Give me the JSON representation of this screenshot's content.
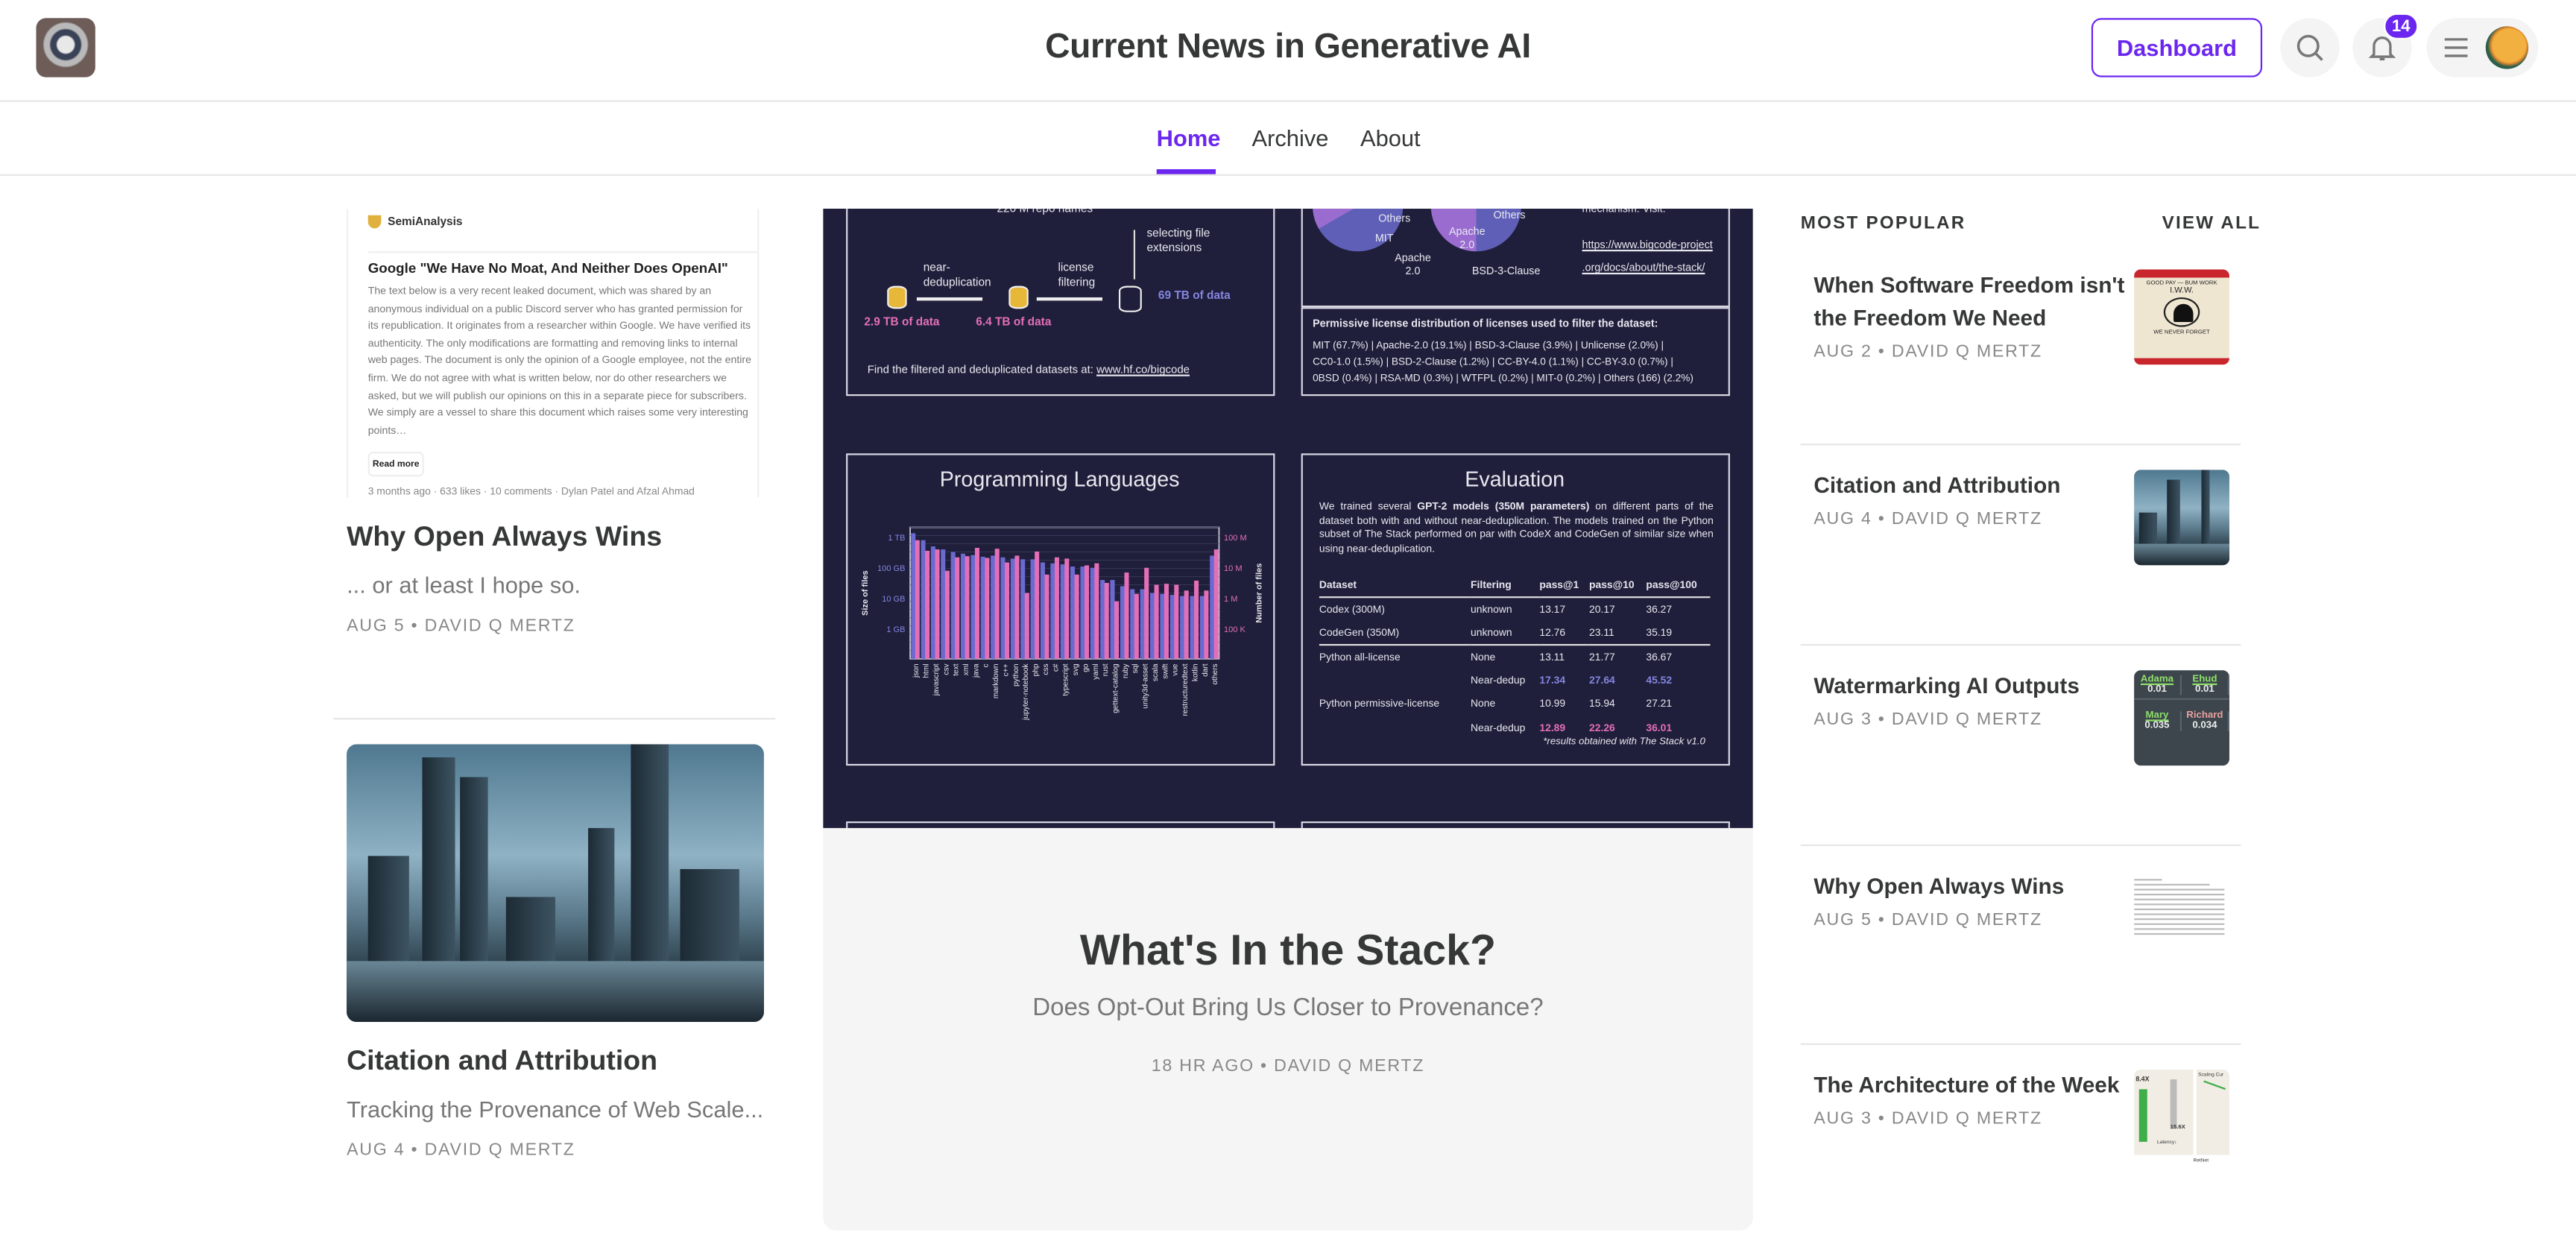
{
  "header": {
    "title": "Current News in Generative AI",
    "dashboard_label": "Dashboard",
    "notification_count": "14",
    "accent_color": "#6b26f0"
  },
  "nav": {
    "tabs": [
      {
        "label": "Home",
        "active": true
      },
      {
        "label": "Archive"
      },
      {
        "label": "About"
      }
    ]
  },
  "left_posts": [
    {
      "title": "Why Open Always Wins",
      "subtitle": "... or at least I hope so.",
      "meta": "AUG 5 • DAVID Q MERTZ",
      "image": {
        "publisher": "SemiAnalysis",
        "heading": "Google \"We Have No Moat, And Neither Does OpenAI\"",
        "body": "The text below is a very recent leaked document, which was shared by an anonymous individual on a public Discord server who has granted permission for its republication. It originates from a researcher within Google. We have verified its authenticity. The only modifications are formatting and removing links to internal web pages. The document is only the opinion of a Google employee, not the entire firm. We do not agree with what is written below, nor do other researchers we asked, but we will publish our opinions on this in a separate piece for subscribers. We simply are a vessel to share this document which raises some very interesting points…",
        "read_more": "Read more",
        "meta": "3 months ago · 633 likes · 10 comments · Dylan Patel and Afzal Ahmad"
      }
    },
    {
      "title": "Citation and Attribution",
      "subtitle": "Tracking the Provenance of Web Scale...",
      "meta": "AUG 4 • DAVID Q MERTZ"
    }
  ],
  "hero": {
    "title": "What's In the Stack?",
    "subtitle": "Does Opt-Out Bring Us Closer to Provenance?",
    "meta": "18 HR AGO • DAVID Q MERTZ",
    "image": {
      "pipeline": {
        "repo_names": "220 M repo names",
        "select_step": "selecting file extensions",
        "license_step": "license filtering",
        "dedup_step": "near-deduplication",
        "size_raw": "69 TB of data",
        "size_license": "6.4 TB of data",
        "size_dedup": "2.9 TB of data",
        "find_text": "Find the filtered and deduplicated datasets at:",
        "find_link": "www.hf.co/bigcode"
      },
      "pies": {
        "labels": [
          "Others",
          "MIT",
          "Apache 2.0",
          "Others",
          "Apache 2.0",
          "BSD-3-Clause"
        ],
        "mechanism": "mechanism. Visit:",
        "link1": "https://www.bigcode-project",
        "link2": ".org/docs/about/the-stack/"
      },
      "license_dist": {
        "title": "Permissive license distribution of licenses used to filter the dataset:",
        "lines": [
          "MIT (67.7%) | Apache-2.0 (19.1%) | BSD-3-Clause (3.9%) | Unlicense (2.0%) |",
          "CC0-1.0 (1.5%) | BSD-2-Clause (1.2%) | CC-BY-4.0 (1.1%) | CC-BY-3.0 (0.7%) |",
          "0BSD (0.4%) | RSA-MD (0.3%) | WTFPL (0.2%) | MIT-0 (0.2%) | Others (166) (2.2%)"
        ]
      },
      "languages_chart": {
        "type": "bar",
        "title": "Programming Languages",
        "ylabel": "Size of files",
        "y2label": "Number of files",
        "yticks": [
          "1 TB",
          "100 GB",
          "10 GB",
          "1 GB"
        ],
        "y2ticks": [
          "100 M",
          "10 M",
          "1 M",
          "100 K"
        ],
        "log_scale": true,
        "categories": [
          "json",
          "html",
          "javascript",
          "csv",
          "text",
          "xml",
          "java",
          "c",
          "markdown",
          "c++",
          "python",
          "jupyter-notebook",
          "php",
          "css",
          "c#",
          "typescript",
          "svg",
          "go",
          "yaml",
          "rust",
          "gettext-catalog",
          "ruby",
          "sql",
          "unity3d-asset",
          "scala",
          "swift",
          "vue",
          "restructuredtext",
          "kotlin",
          "dart",
          "others"
        ],
        "series": [
          {
            "axis": "size_gb",
            "color": "#6a6ad0",
            "values": [
              1350,
              800,
              500,
              400,
              330,
              290,
              260,
              230,
              250,
              220,
              200,
              190,
              190,
              150,
              140,
              130,
              110,
              110,
              100,
              40,
              40,
              25,
              20,
              20,
              15,
              14,
              13,
              12,
              12,
              12,
              250
            ]
          },
          {
            "axis": "files_millions",
            "color": "#e46fb8",
            "values": [
              80,
              36,
              40,
              8,
              22,
              24,
              45,
              21,
              42,
              15,
              25,
              1.5,
              34,
              6,
              22,
              20,
              6,
              12,
              14,
              3.2,
              0.8,
              7,
              1.4,
              10,
              2.8,
              3,
              2.8,
              1.8,
              3.8,
              1.8,
              40
            ]
          }
        ],
        "colors": {
          "size": "#6a6ad0",
          "files": "#e46fb8"
        }
      },
      "evaluation": {
        "title": "Evaluation",
        "intro_pre": "We trained several ",
        "intro_bold": "GPT-2 models (350M parameters)",
        "intro_post": " on different parts of the dataset both with and without near-deduplication. The models trained on the Python subset of The Stack performed on par with CodeX and CodeGen of similar size when using near-deduplication.",
        "columns": [
          "Dataset",
          "Filtering",
          "pass@1",
          "pass@10",
          "pass@100"
        ],
        "rows": [
          [
            "Codex (300M)",
            "unknown",
            "13.17",
            "20.17",
            "36.27"
          ],
          [
            "CodeGen (350M)",
            "unknown",
            "12.76",
            "23.11",
            "35.19"
          ],
          [
            "Python all-license",
            "None",
            "13.11",
            "21.77",
            "36.67"
          ],
          [
            "",
            "Near-dedup",
            "17.34",
            "27.64",
            "45.52"
          ],
          [
            "Python permissive-license",
            "None",
            "10.99",
            "15.94",
            "27.21"
          ],
          [
            "",
            "Near-dedup",
            "12.89",
            "22.26",
            "36.01"
          ]
        ],
        "footnote": "*results obtained with The Stack v1.0"
      }
    }
  },
  "popular": {
    "heading": "MOST POPULAR",
    "view_all": "VIEW ALL",
    "items": [
      {
        "title": "When Software Freedom isn't the Freedom We Need",
        "meta": "AUG 2 • DAVID Q MERTZ",
        "thumb": "poster",
        "poster_text": [
          "GOOD PAY — BUM WORK",
          "I.W.W.",
          "WE NEVER FORGET"
        ]
      },
      {
        "title": "Citation and Attribution",
        "meta": "AUG 4 • DAVID Q MERTZ",
        "thumb": "city"
      },
      {
        "title": "Watermarking AI Outputs",
        "meta": "AUG 3 • DAVID Q MERTZ",
        "thumb": "table",
        "cells": [
          [
            "Adama",
            "Ehud"
          ],
          [
            "0.01",
            "0.01"
          ],
          [
            "Mary",
            "Richard"
          ],
          [
            "0.035",
            "0.034"
          ]
        ]
      },
      {
        "title": "Why Open Always Wins",
        "meta": "AUG 5 • DAVID Q MERTZ",
        "thumb": "doc"
      },
      {
        "title": "The Architecture of the Week",
        "meta": "AUG 3 • DAVID Q MERTZ",
        "thumb": "chart",
        "chart_text": [
          "8.4X",
          "15.6X",
          "Scaling Cur",
          "Latency↓",
          "RetNet"
        ]
      }
    ]
  }
}
